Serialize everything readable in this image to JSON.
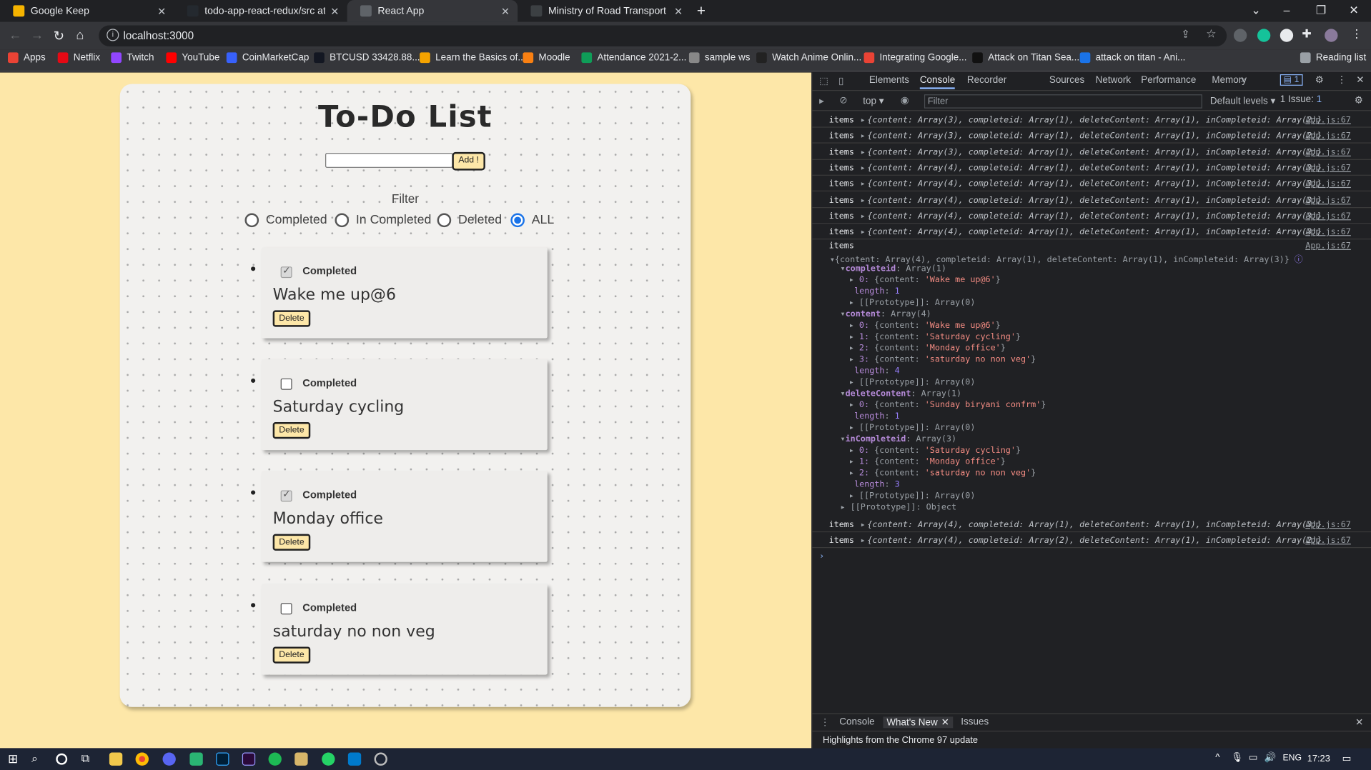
{
  "browser": {
    "tabs": [
      {
        "title": "Google Keep",
        "color": "#f6b400"
      },
      {
        "title": "todo-app-react-redux/src at master",
        "color": "#24292f"
      },
      {
        "title": "React App",
        "color": "#5f6368"
      },
      {
        "title": "Ministry of Road Transport and Highways",
        "color": "#3c4043"
      }
    ],
    "address": "localhost:3000",
    "bookmarks": [
      {
        "label": "Apps",
        "color": "#ea4335"
      },
      {
        "label": "Netflix",
        "color": "#e50914"
      },
      {
        "label": "Twitch",
        "color": "#9146ff"
      },
      {
        "label": "YouTube",
        "color": "#ff0000"
      },
      {
        "label": "CoinMarketCap",
        "color": "#3861fb"
      },
      {
        "label": "BTCUSD 33428.88...",
        "color": "#131722"
      },
      {
        "label": "Learn the Basics of...",
        "color": "#f4a300"
      },
      {
        "label": "Moodle",
        "color": "#f98012"
      },
      {
        "label": "Attendance 2021-2...",
        "color": "#0f9d58"
      },
      {
        "label": "sample ws",
        "color": "#888888"
      },
      {
        "label": "Watch Anime Onlin...",
        "color": "#222222"
      },
      {
        "label": "Integrating Google...",
        "color": "#ea4335"
      },
      {
        "label": "Attack on Titan Sea...",
        "color": "#111111"
      },
      {
        "label": "attack on titan - Ani...",
        "color": "#1a73e8"
      }
    ],
    "reading_list": "Reading list"
  },
  "app": {
    "title": "To-Do List",
    "input_value": "",
    "add_label": "Add !",
    "filter_label": "Filter",
    "filters": [
      "Completed",
      "In Completed",
      "Deleted",
      "ALL"
    ],
    "selected_filter": "ALL",
    "todos": [
      {
        "text": "Wake me up@6",
        "completed": true,
        "checkbox_label": "Completed",
        "delete_label": "Delete"
      },
      {
        "text": "Saturday cycling",
        "completed": false,
        "checkbox_label": "Completed",
        "delete_label": "Delete"
      },
      {
        "text": "Monday office",
        "completed": true,
        "checkbox_label": "Completed",
        "delete_label": "Delete"
      },
      {
        "text": "saturday no non veg",
        "completed": false,
        "checkbox_label": "Completed",
        "delete_label": "Delete"
      }
    ]
  },
  "devtools": {
    "tabs": [
      "Elements",
      "Console",
      "Recorder",
      "Sources",
      "Network",
      "Performance",
      "Memory"
    ],
    "active_tab": "Console",
    "issues_badge": "1",
    "context": "top",
    "filter_placeholder": "Filter",
    "levels": "Default levels",
    "issue_count": "1 Issue:",
    "issue_num": "1",
    "logs_before": [
      {
        "label": "items",
        "obj": "{content: Array(3), completeid: Array(1), deleteContent: Array(1), inCompleteid: Array(2)}",
        "src": "App.js:67"
      },
      {
        "label": "items",
        "obj": "{content: Array(3), completeid: Array(1), deleteContent: Array(1), inCompleteid: Array(2)}",
        "src": "App.js:67"
      },
      {
        "label": "items",
        "obj": "{content: Array(3), completeid: Array(1), deleteContent: Array(1), inCompleteid: Array(2)}",
        "src": "App.js:67"
      },
      {
        "label": "items",
        "obj": "{content: Array(4), completeid: Array(1), deleteContent: Array(1), inCompleteid: Array(3)}",
        "src": "App.js:67"
      },
      {
        "label": "items",
        "obj": "{content: Array(4), completeid: Array(1), deleteContent: Array(1), inCompleteid: Array(3)}",
        "src": "App.js:67"
      },
      {
        "label": "items",
        "obj": "{content: Array(4), completeid: Array(1), deleteContent: Array(1), inCompleteid: Array(3)}",
        "src": "App.js:67"
      },
      {
        "label": "items",
        "obj": "{content: Array(4), completeid: Array(1), deleteContent: Array(1), inCompleteid: Array(3)}",
        "src": "App.js:67"
      },
      {
        "label": "items",
        "obj": "{content: Array(4), completeid: Array(1), deleteContent: Array(1), inCompleteid: Array(3)}",
        "src": "App.js:67"
      }
    ],
    "expanded": {
      "label": "items",
      "src": "App.js:67",
      "summary": "{content: Array(4), completeid: Array(1), deleteContent: Array(1), inCompleteid: Array(3)}",
      "completeid": {
        "title": "Array(1)",
        "items": [
          "Wake me up@6"
        ],
        "length": "1",
        "proto": "Array(0)"
      },
      "content": {
        "title": "Array(4)",
        "items": [
          "Wake me up@6",
          "Saturday cycling",
          "Monday office",
          "saturday no non veg"
        ],
        "length": "4",
        "proto": "Array(0)"
      },
      "deleteContent": {
        "title": "Array(1)",
        "items": [
          "Sunday biryani confrm"
        ],
        "length": "1",
        "proto": "Array(0)"
      },
      "inCompleteid": {
        "title": "Array(3)",
        "items": [
          "Saturday cycling",
          "Monday office",
          "saturday no non veg"
        ],
        "length": "3",
        "proto": "Array(0)"
      },
      "proto": "Object"
    },
    "logs_after": [
      {
        "label": "items",
        "obj": "{content: Array(4), completeid: Array(1), deleteContent: Array(1), inCompleteid: Array(3)}",
        "src": "App.js:67"
      },
      {
        "label": "items",
        "obj": "{content: Array(4), completeid: Array(2), deleteContent: Array(1), inCompleteid: Array(2)}",
        "src": "App.js:67"
      }
    ],
    "drawer_tabs": [
      "Console",
      "What's New",
      "Issues"
    ],
    "drawer_active": "What's New",
    "drawer_message": "Highlights from the Chrome 97 update"
  },
  "taskbar": {
    "lang": "ENG",
    "time": "17:23"
  }
}
